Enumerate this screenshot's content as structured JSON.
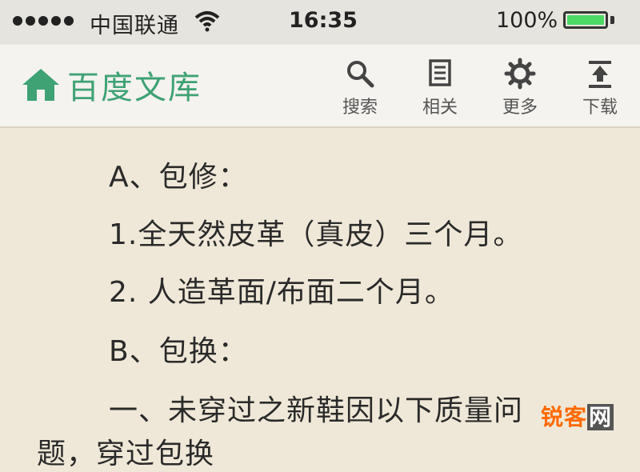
{
  "status_bar": {
    "carrier": "中国联通",
    "time": "16:35",
    "battery": "100%"
  },
  "nav": {
    "brand": "百度文库",
    "actions": [
      {
        "label": "搜索",
        "icon": "search-icon"
      },
      {
        "label": "相关",
        "icon": "related-icon"
      },
      {
        "label": "更多",
        "icon": "gear-icon"
      },
      {
        "label": "下载",
        "icon": "download-icon"
      }
    ]
  },
  "content": {
    "lines": [
      "A、包修：",
      "1.全天然皮革（真皮）三个月。",
      "2. 人造革面/布面二个月。",
      "B、包换：",
      "一、未穿过之新鞋因以下质量问",
      "题，穿过包换"
    ]
  },
  "watermark": {
    "prefix": "锐客",
    "suffix": "网"
  },
  "colors": {
    "brand_green": "#3fa275",
    "battery_green": "#4cd964",
    "page_bg": "#efe8d8"
  }
}
